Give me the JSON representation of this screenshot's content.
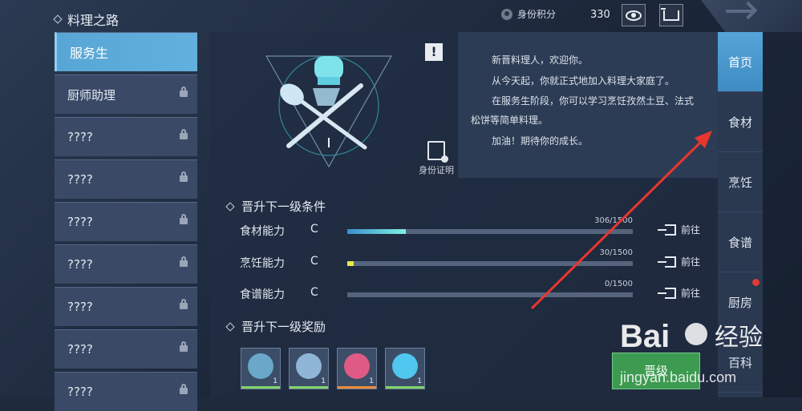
{
  "header": {
    "title": "料理之路",
    "score_label": "身份积分",
    "score_value": "330"
  },
  "levels": [
    {
      "label": "服务生",
      "locked": false,
      "active": true
    },
    {
      "label": "厨师助理",
      "locked": true
    },
    {
      "label": "????",
      "locked": true
    },
    {
      "label": "????",
      "locked": true
    },
    {
      "label": "????",
      "locked": true
    },
    {
      "label": "????",
      "locked": true
    },
    {
      "label": "????",
      "locked": true
    },
    {
      "label": "????",
      "locked": true
    },
    {
      "label": "????",
      "locked": true
    }
  ],
  "panel": {
    "id_cert_label": "身份证明",
    "intro": [
      "新晋料理人，欢迎你。",
      "从今天起，你就正式地加入料理大家庭了。",
      "在服务生阶段，你可以学习烹饪孜然土豆、法式",
      "松饼等简单料理。",
      "加油！期待你的成长。"
    ],
    "conditions_title": "晋升下一级条件",
    "stats": [
      {
        "name": "食材能力",
        "grade": "C",
        "value": "306/1500",
        "progress": 0.204,
        "color": "#5fd2e6"
      },
      {
        "name": "烹饪能力",
        "grade": "C",
        "value": "30/1500",
        "progress": 0.02,
        "color": "#e8e84a"
      },
      {
        "name": "食谱能力",
        "grade": "C",
        "value": "0/1500",
        "progress": 0.0,
        "color": "#5fd2e6"
      }
    ],
    "goto_label": "前往",
    "rewards_title": "晋升下一级奖励",
    "rewards": [
      {
        "count": "1",
        "icon": "chef-emblem-icon",
        "strip": "#7fd36a"
      },
      {
        "count": "1",
        "icon": "crystal-icon",
        "strip": "#7fd36a"
      },
      {
        "count": "1",
        "icon": "donut-icon",
        "strip": "#e98a3a"
      },
      {
        "count": "1",
        "icon": "diamond-icon",
        "strip": "#7fd36a"
      }
    ],
    "upgrade_label": "晋级"
  },
  "nav": [
    "首页",
    "食材",
    "烹饪",
    "食谱",
    "厨房",
    "百科"
  ],
  "watermark": {
    "brand": "Bai 经验",
    "url": "jingyan.baidu.com"
  },
  "colors": {
    "accent": "#58a6d6",
    "annotation_arrow": "#e8362f"
  }
}
